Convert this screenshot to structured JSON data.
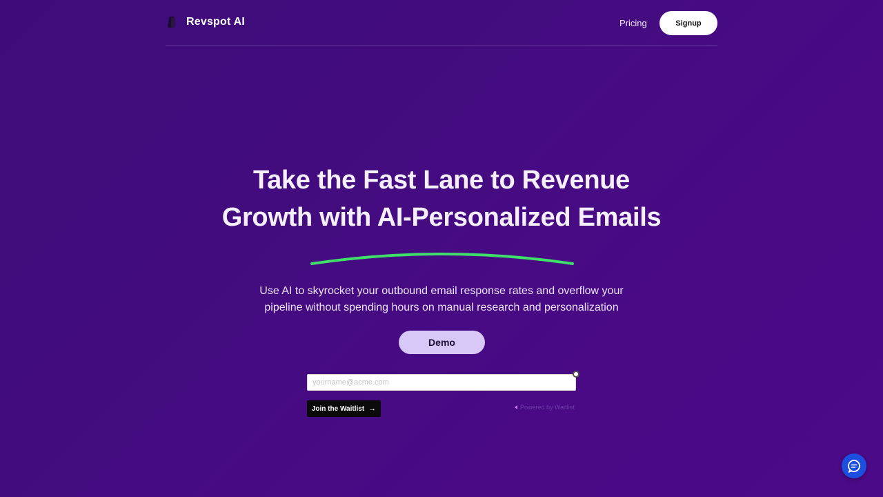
{
  "nav": {
    "brand": "Revspot AI",
    "pricing_label": "Pricing",
    "signup_label": "Signup"
  },
  "hero": {
    "headline_line1": "Take the Fast Lane to Revenue",
    "headline_line2": "Growth with AI-Personalized Emails",
    "subtitle_line1": "Use AI to skyrocket your outbound email response rates and overflow your",
    "subtitle_line2": "pipeline without spending hours on manual research and personalization",
    "demo_label": "Demo"
  },
  "waitlist": {
    "email_placeholder": "yourname@acme.com",
    "button_label": "Join the Waitlist",
    "button_arrow": "→",
    "powered_by": "Powered by Waitlist"
  },
  "icons": {
    "logo": "revspot-logo-icon",
    "underline": "green-swoosh-underline",
    "chat": "chat-bubble-icon"
  },
  "colors": {
    "background": "#430c7f",
    "accent_green": "#3ee06a",
    "demo_button": "#d8c8f7",
    "chat_button": "#1c4fe0"
  }
}
